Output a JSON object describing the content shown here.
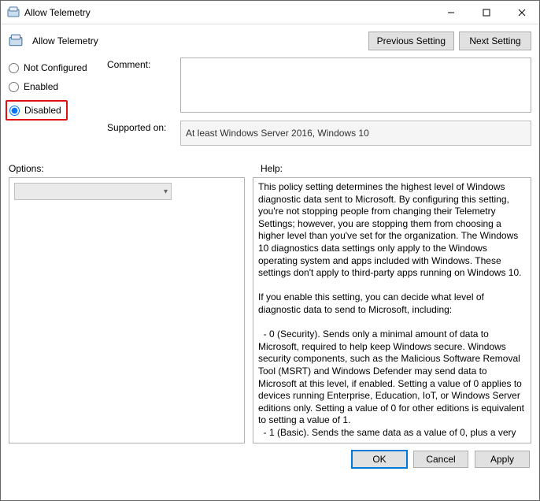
{
  "window": {
    "title": "Allow Telemetry",
    "subtitle": "Allow Telemetry"
  },
  "nav": {
    "prev": "Previous Setting",
    "next": "Next Setting"
  },
  "radios": {
    "not_configured": "Not Configured",
    "enabled": "Enabled",
    "disabled": "Disabled",
    "selected": "disabled"
  },
  "labels": {
    "comment": "Comment:",
    "supported": "Supported on:",
    "options": "Options:",
    "help": "Help:"
  },
  "fields": {
    "comment": "",
    "supported": "At least Windows Server 2016, Windows 10"
  },
  "help_text": "This policy setting determines the highest level of Windows diagnostic data sent to Microsoft. By configuring this setting, you're not stopping people from changing their Telemetry Settings; however, you are stopping them from choosing a higher level than you've set for the organization. The Windows 10 diagnostics data settings only apply to the Windows operating system and apps included with Windows. These settings don't apply to third-party apps running on Windows 10.\n\nIf you enable this setting, you can decide what level of diagnostic data to send to Microsoft, including:\n\n  - 0 (Security). Sends only a minimal amount of data to Microsoft, required to help keep Windows secure. Windows security components, such as the Malicious Software Removal Tool (MSRT) and Windows Defender may send data to Microsoft at this level, if enabled. Setting a value of 0 applies to devices running Enterprise, Education, IoT, or Windows Server editions only. Setting a value of 0 for other editions is equivalent to setting a value of 1.\n  - 1 (Basic). Sends the same data as a value of 0, plus a very",
  "buttons": {
    "ok": "OK",
    "cancel": "Cancel",
    "apply": "Apply"
  }
}
